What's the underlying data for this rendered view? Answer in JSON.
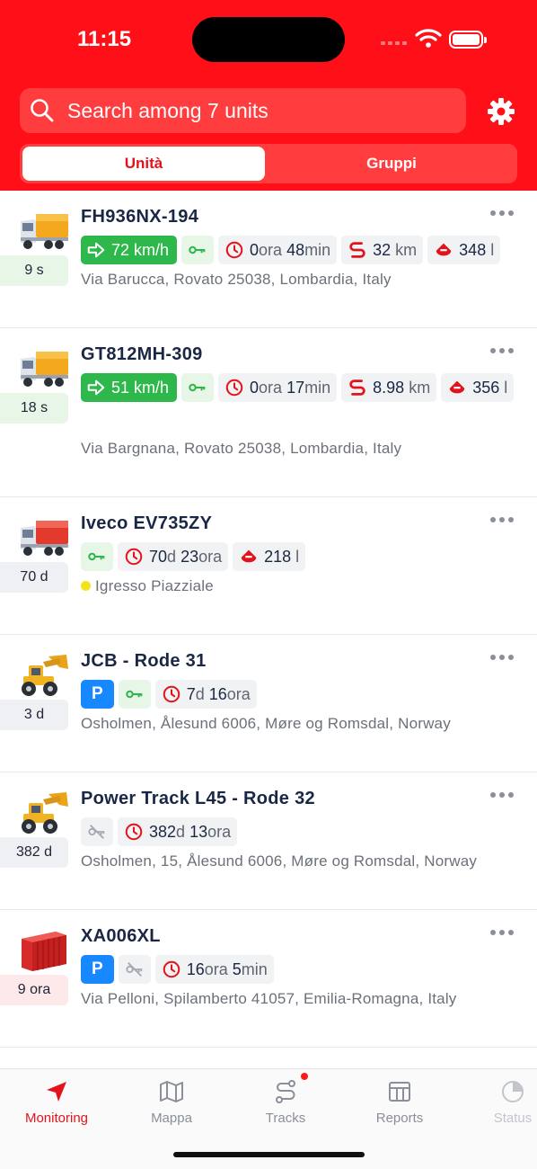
{
  "status_bar": {
    "time": "11:15"
  },
  "search": {
    "placeholder": "Search among 7 units"
  },
  "segments": {
    "units": "Unità",
    "groups": "Gruppi"
  },
  "colors": {
    "brand_red": "#ff0f17",
    "speed_green": "#2eb74a",
    "parking_blue": "#1788ff",
    "text_navy": "#1a2744"
  },
  "units": [
    {
      "name": "FH936NX-194",
      "icon": "truck-yellow-icon",
      "age": "9 s",
      "speed": "72 km/h",
      "ignition": "on",
      "duration": {
        "v1": "0",
        "u1": "ora",
        "v2": "48",
        "u2": "min"
      },
      "distance": {
        "v": "32",
        "u": "km"
      },
      "fuel": {
        "v": "348",
        "u": "l"
      },
      "address": "Via Barucca, Rovato 25038, Lombardia, Italy"
    },
    {
      "name": "GT812MH-309",
      "icon": "truck-yellow-icon",
      "age": "18 s",
      "speed": "51 km/h",
      "ignition": "on",
      "duration": {
        "v1": "0",
        "u1": "ora",
        "v2": "17",
        "u2": "min"
      },
      "distance": {
        "v": "8.98",
        "u": "km"
      },
      "fuel": {
        "v": "356",
        "u": "l"
      },
      "address": "Via Bargnana, Rovato 25038, Lombardia, Italy"
    },
    {
      "name": "Iveco EV735ZY",
      "icon": "truck-red-icon",
      "age": "70 d",
      "ignition": "on",
      "duration": {
        "v1": "70",
        "u1": "d",
        "v2": "23",
        "u2": "ora"
      },
      "fuel": {
        "v": "218",
        "u": "l"
      },
      "address": "Igresso Piazziale"
    },
    {
      "name": "JCB - Rode 31",
      "icon": "wheel-loader-icon",
      "age": "3 d",
      "parking": "P",
      "ignition": "on",
      "duration": {
        "v1": "7",
        "u1": "d",
        "v2": "16",
        "u2": "ora"
      },
      "address": "Osholmen, Ålesund 6006, Møre og Romsdal, Norway"
    },
    {
      "name": "Power Track L45 - Rode 32",
      "icon": "wheel-loader-icon",
      "age": "382 d",
      "ignition": "off",
      "duration": {
        "v1": "382",
        "u1": "d",
        "v2": "13",
        "u2": "ora"
      },
      "address": "Osholmen, 15, Ålesund 6006, Møre og Romsdal, Norway"
    },
    {
      "name": "XA006XL",
      "icon": "container-icon",
      "age": "9 ora",
      "parking": "P",
      "ignition": "off",
      "duration": {
        "v1": "16",
        "u1": "ora",
        "v2": "5",
        "u2": "min"
      },
      "address": "Via Pelloni, Spilamberto 41057, Emilia-Romagna, Italy"
    }
  ],
  "tabbar": {
    "monitoring": "Monitoring",
    "map": "Mappa",
    "tracks": "Tracks",
    "reports": "Reports",
    "status": "Status"
  }
}
